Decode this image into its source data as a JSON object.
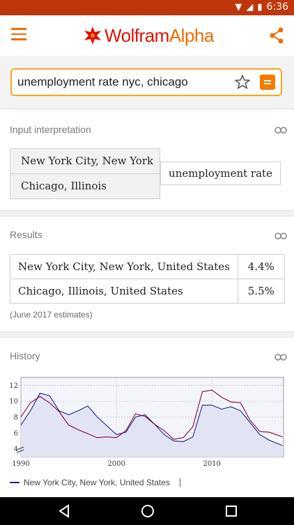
{
  "status_bar": {
    "time": "6:36"
  },
  "app": {
    "brand_part1": "Wolfram",
    "brand_part2": "Alpha"
  },
  "search": {
    "query": "unemployment rate nyc, chicago"
  },
  "input_interpretation": {
    "title": "Input interpretation",
    "places": [
      "New York City, New York",
      "Chicago, Illinois"
    ],
    "property": "unemployment rate"
  },
  "results": {
    "title": "Results",
    "rows": [
      {
        "place": "New York City, New York, United States",
        "value": "4.4%"
      },
      {
        "place": "Chicago, Illinois, United States",
        "value": "5.5%"
      }
    ],
    "note": "(June 2017 estimates)"
  },
  "history": {
    "title": "History",
    "legend_series": "New York City, New York, United States"
  },
  "chart_data": {
    "type": "line",
    "x_ticks": [
      1990,
      2000,
      2010
    ],
    "y_ticks": [
      4,
      6,
      8,
      10,
      12
    ],
    "xlim": [
      1990,
      2017.5
    ],
    "ylim": [
      3,
      13
    ],
    "series": [
      {
        "name": "New York City, New York, United States",
        "color": "#1a237e",
        "x": [
          1990,
          1991,
          1992,
          1993,
          1994,
          1995,
          1996,
          1997,
          1998,
          1999,
          2000,
          2001,
          2002,
          2003,
          2004,
          2005,
          2006,
          2007,
          2008,
          2009,
          2010,
          2011,
          2012,
          2013,
          2014,
          2015,
          2016,
          2017.4
        ],
        "y": [
          7.0,
          8.8,
          11.0,
          10.7,
          8.8,
          8.3,
          8.8,
          9.4,
          8.0,
          6.9,
          5.8,
          6.1,
          8.0,
          8.3,
          7.1,
          5.8,
          5.0,
          4.9,
          5.5,
          9.5,
          9.5,
          9.0,
          9.3,
          8.8,
          7.3,
          5.8,
          5.1,
          4.4
        ]
      },
      {
        "name": "Chicago, Illinois",
        "color": "#800040",
        "x": [
          1990,
          1991,
          1992,
          1993,
          1994,
          1995,
          1996,
          1997,
          1998,
          1999,
          2000,
          2001,
          2002,
          2003,
          2004,
          2005,
          2006,
          2007,
          2008,
          2009,
          2010,
          2011,
          2012,
          2013,
          2014,
          2015,
          2016,
          2017.4
        ],
        "y": [
          8.0,
          9.8,
          10.6,
          9.8,
          8.7,
          7.0,
          6.4,
          5.9,
          5.4,
          5.5,
          5.4,
          6.3,
          8.4,
          8.1,
          7.1,
          6.3,
          5.2,
          5.4,
          6.8,
          11.2,
          11.4,
          10.5,
          9.9,
          9.8,
          7.6,
          6.2,
          6.1,
          5.5
        ]
      }
    ]
  }
}
